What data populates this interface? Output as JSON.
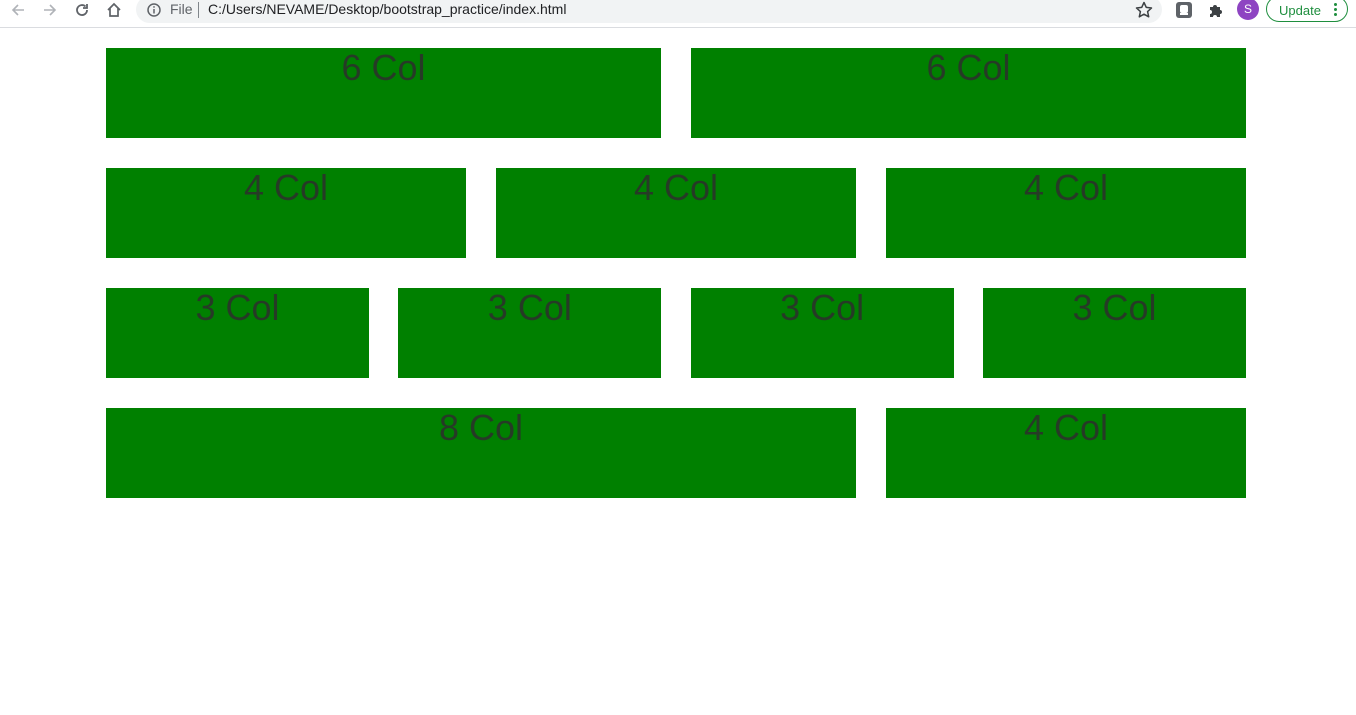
{
  "browser": {
    "file_label": "File",
    "url": "C:/Users/NEVAME/Desktop/bootstrap_practice/index.html",
    "profile_initial": "S",
    "update_label": "Update",
    "accent_color": "#1e8e3e",
    "profile_color": "#8e44c2"
  },
  "page": {
    "box_color": "#008000",
    "text_color": "#263a26",
    "rows": [
      {
        "cols": [
          {
            "label": "6 Col",
            "span": 6
          },
          {
            "label": "6 Col",
            "span": 6
          }
        ]
      },
      {
        "cols": [
          {
            "label": "4 Col",
            "span": 4
          },
          {
            "label": "4 Col",
            "span": 4
          },
          {
            "label": "4 Col",
            "span": 4
          }
        ]
      },
      {
        "cols": [
          {
            "label": "3 Col",
            "span": 3
          },
          {
            "label": "3 Col",
            "span": 3
          },
          {
            "label": "3 Col",
            "span": 3
          },
          {
            "label": "3 Col",
            "span": 3
          }
        ]
      },
      {
        "cols": [
          {
            "label": "8 Col",
            "span": 8
          },
          {
            "label": "4 Col",
            "span": 4
          }
        ]
      }
    ]
  }
}
